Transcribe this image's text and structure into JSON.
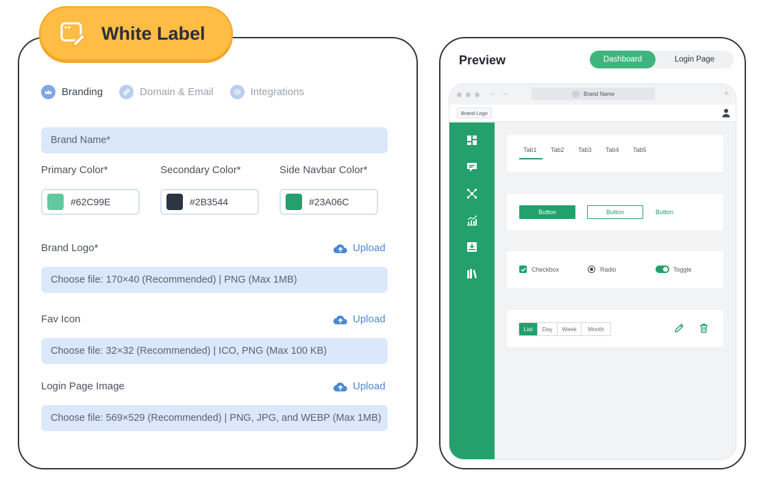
{
  "badge": {
    "title": "White Label",
    "icon": "window-edit-icon"
  },
  "tabs": [
    {
      "label": "Branding",
      "icon": "crown-icon",
      "active": true
    },
    {
      "label": "Domain & Email",
      "icon": "link-icon",
      "active": false
    },
    {
      "label": "Integrations",
      "icon": "gear-icon",
      "active": false
    }
  ],
  "form": {
    "brand_name_placeholder": "Brand Name*",
    "primary_color_label": "Primary Color*",
    "secondary_color_label": "Secondary Color*",
    "side_navbar_color_label": "Side Navbar Color*",
    "primary_color": "#62C99E",
    "secondary_color": "#2B3544",
    "side_navbar_color": "#23A06C",
    "brand_logo_label": "Brand Logo*",
    "brand_logo_hint": "Choose file: 170×40 (Recommended) | PNG (Max 1MB)",
    "fav_icon_label": "Fav Icon",
    "fav_icon_hint": "Choose file: 32×32 (Recommended) | ICO, PNG (Max 100 KB)",
    "login_image_label": "Login Page Image",
    "login_image_hint": "Choose file: 569×529 (Recommended) | PNG, JPG, and WEBP (Max 1MB)",
    "upload_label": "Upload"
  },
  "preview": {
    "title": "Preview",
    "toggle": {
      "dashboard": "Dashboard",
      "login": "Login Page",
      "selected": "Dashboard"
    },
    "browser": {
      "url_text": "Brand Name",
      "brand_logo": "Brand Logo"
    },
    "tabs": [
      "Tab1",
      "Tab2",
      "Tab3",
      "Tab4",
      "Tab5"
    ],
    "button_label": "Button",
    "checkbox_label": "Checkbox",
    "radio_label": "Radio",
    "toggle_label": "Toggle",
    "views": [
      "List",
      "Day",
      "Week",
      "Month"
    ],
    "nav_icons": [
      "dashboard-icon",
      "comment-icon",
      "network-icon",
      "chart-icon",
      "download-icon",
      "books-icon"
    ]
  },
  "colors": {
    "accent": "#23A06C",
    "badge": "#FFBD45",
    "field_bg": "#DBE8FB",
    "link": "#4B87D6"
  }
}
